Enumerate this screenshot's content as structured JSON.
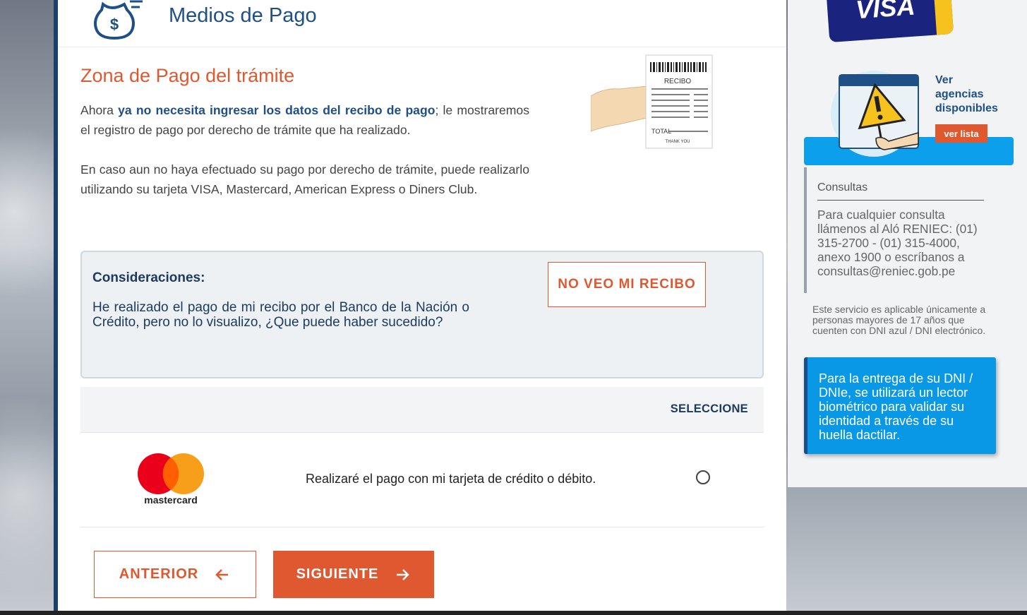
{
  "header": {
    "title": "Medios de Pago",
    "icon": "money-bag-icon"
  },
  "zona": {
    "title": "Zona de Pago del trámite",
    "para1_prefix": "Ahora ",
    "para1_bold": "ya no necesita ingresar los datos del recibo de pago",
    "para1_suffix": "; le mostraremos el registro de pago por derecho de trámite que ha realizado.",
    "para2": "En caso aun no haya efectuado su pago por derecho de trámite, puede realizarlo utilizando su tarjeta VISA, Mastercard, American Express o Diners Club.",
    "receipt_label": "RECIBO",
    "receipt_total": "TOTAL",
    "receipt_thanks": "THANK YOU"
  },
  "consideraciones": {
    "heading": "Consideraciones:",
    "text": "He realizado el pago de mi recibo por el Banco de la Nación o Crédito, pero no lo visualizo, ¿Que puede haber sucedido?",
    "button": "NO VEO MI RECIBO"
  },
  "seleccione": {
    "header": "SELECCIONE"
  },
  "payment_option": {
    "logo_text": "mastercard",
    "label": "Realizaré el pago con mi tarjeta de crédito o débito.",
    "selected": false
  },
  "nav": {
    "anterior": "ANTERIOR",
    "siguiente": "SIGUIENTE"
  },
  "sidebar": {
    "visa_text": "VISA",
    "agencias_line1": "Ver",
    "agencias_line2": "agencias",
    "agencias_line3": "disponibles",
    "ver_lista": "ver lista",
    "consultas_heading": "Consultas",
    "consultas_text": "Para cualquier consulta llámenos al Aló RENIEC: (01) 315-2700 - (01) 315-4000, anexo 1900 o escríbanos a consultas@reniec.gob.pe",
    "note": "Este servicio es aplicable únicamente a personas mayores de 17 años que cuenten con DNI azul / DNI electrónico.",
    "dni_box": "Para la entrega de su DNI / DNIe, se utilizará un lector biométrico para validar su identidad a través de su huella dactilar."
  },
  "colors": {
    "accent": "#e0582f",
    "brand_blue": "#1e4f86",
    "sky": "#0898e6"
  }
}
